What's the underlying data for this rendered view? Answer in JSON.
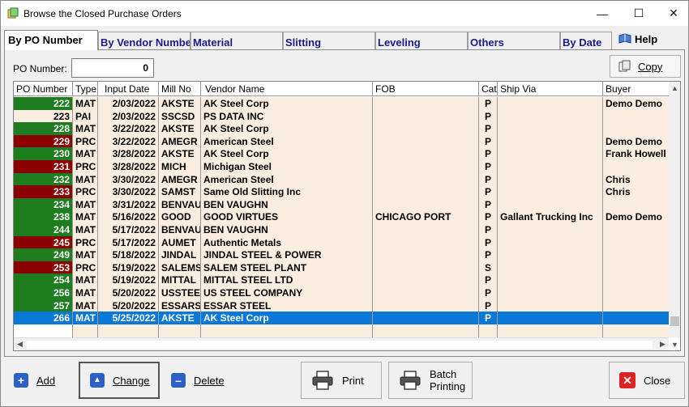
{
  "window": {
    "title": "Browse the Closed Purchase Orders",
    "minimize": "—",
    "maximize": "☐",
    "close": "✕"
  },
  "tabs": [
    "By PO Number",
    "By Vendor Number",
    "Material",
    "Slitting",
    "Leveling",
    "Others",
    "By Date"
  ],
  "help_label": "Help",
  "po_label": "PO Number:",
  "po_value": "0",
  "copy_label": "Copy",
  "columns": [
    "PO Number",
    "Type",
    "Input Date",
    "Mill No",
    "Vendor Name",
    "FOB",
    "Cat",
    "Ship Via",
    "Buyer"
  ],
  "rows": [
    {
      "po": "222",
      "status": "green",
      "type": "MAT",
      "date": "2/03/2022",
      "mill": "AKSTE",
      "vendor": "AK Steel Corp",
      "fob": "",
      "cat": "P",
      "ship": "",
      "buyer": "Demo Demo"
    },
    {
      "po": "223",
      "status": "plain",
      "type": "PAI",
      "date": "2/03/2022",
      "mill": "SSCSD",
      "vendor": "PS DATA INC",
      "fob": "",
      "cat": "P",
      "ship": "",
      "buyer": ""
    },
    {
      "po": "228",
      "status": "green",
      "type": "MAT",
      "date": "3/22/2022",
      "mill": "AKSTE",
      "vendor": "AK Steel Corp",
      "fob": "",
      "cat": "P",
      "ship": "",
      "buyer": ""
    },
    {
      "po": "229",
      "status": "red",
      "type": "PRC",
      "date": "3/22/2022",
      "mill": "AMEGR",
      "vendor": "American Steel",
      "fob": "",
      "cat": "P",
      "ship": "",
      "buyer": "Demo Demo"
    },
    {
      "po": "230",
      "status": "green",
      "type": "MAT",
      "date": "3/28/2022",
      "mill": "AKSTE",
      "vendor": "AK Steel Corp",
      "fob": "",
      "cat": "P",
      "ship": "",
      "buyer": "Frank Howell"
    },
    {
      "po": "231",
      "status": "red",
      "type": "PRC",
      "date": "3/28/2022",
      "mill": "MICH",
      "vendor": "Michigan Steel",
      "fob": "",
      "cat": "P",
      "ship": "",
      "buyer": ""
    },
    {
      "po": "232",
      "status": "green",
      "type": "MAT",
      "date": "3/30/2022",
      "mill": "AMEGR",
      "vendor": "American Steel",
      "fob": "",
      "cat": "P",
      "ship": "",
      "buyer": "Chris"
    },
    {
      "po": "233",
      "status": "red",
      "type": "PRC",
      "date": "3/30/2022",
      "mill": "SAMST",
      "vendor": "Same Old Slitting Inc",
      "fob": "",
      "cat": "P",
      "ship": "",
      "buyer": "Chris"
    },
    {
      "po": "234",
      "status": "green",
      "type": "MAT",
      "date": "3/31/2022",
      "mill": "BENVAU",
      "vendor": "BEN VAUGHN",
      "fob": "",
      "cat": "P",
      "ship": "",
      "buyer": ""
    },
    {
      "po": "238",
      "status": "green",
      "type": "MAT",
      "date": "5/16/2022",
      "mill": "GOOD",
      "vendor": "GOOD VIRTUES",
      "fob": "CHICAGO PORT",
      "cat": "P",
      "ship": "Gallant Trucking Inc",
      "buyer": "Demo Demo"
    },
    {
      "po": "244",
      "status": "green",
      "type": "MAT",
      "date": "5/17/2022",
      "mill": "BENVAU",
      "vendor": "BEN VAUGHN",
      "fob": "",
      "cat": "P",
      "ship": "",
      "buyer": ""
    },
    {
      "po": "245",
      "status": "red",
      "type": "PRC",
      "date": "5/17/2022",
      "mill": "AUMET",
      "vendor": "Authentic Metals",
      "fob": "",
      "cat": "P",
      "ship": "",
      "buyer": ""
    },
    {
      "po": "249",
      "status": "green",
      "type": "MAT",
      "date": "5/18/2022",
      "mill": "JINDAL",
      "vendor": "JINDAL STEEL & POWER",
      "fob": "",
      "cat": "P",
      "ship": "",
      "buyer": ""
    },
    {
      "po": "253",
      "status": "red",
      "type": "PRC",
      "date": "5/19/2022",
      "mill": "SALEMS",
      "vendor": "SALEM STEEL PLANT",
      "fob": "",
      "cat": "S",
      "ship": "",
      "buyer": ""
    },
    {
      "po": "254",
      "status": "green",
      "type": "MAT",
      "date": "5/19/2022",
      "mill": "MITTAL",
      "vendor": "MITTAL STEEL LTD",
      "fob": "",
      "cat": "P",
      "ship": "",
      "buyer": ""
    },
    {
      "po": "256",
      "status": "green",
      "type": "MAT",
      "date": "5/20/2022",
      "mill": "USSTEE",
      "vendor": "US STEEL COMPANY",
      "fob": "",
      "cat": "P",
      "ship": "",
      "buyer": ""
    },
    {
      "po": "257",
      "status": "green",
      "type": "MAT",
      "date": "5/20/2022",
      "mill": "ESSARS",
      "vendor": " ESSAR STEEL",
      "fob": "",
      "cat": "P",
      "ship": "",
      "buyer": ""
    },
    {
      "po": "266",
      "status": "green",
      "type": "MAT",
      "date": "5/25/2022",
      "mill": "AKSTE",
      "vendor": "AK Steel Corp",
      "fob": "",
      "cat": "P",
      "ship": "",
      "buyer": "",
      "selected": true
    }
  ],
  "buttons": {
    "add": "Add",
    "change": "Change",
    "delete": "Delete",
    "print": "Print",
    "batch_line1": "Batch",
    "batch_line2": "Printing",
    "close": "Close"
  },
  "colors": {
    "green": "#1e7d1e",
    "red": "#8b0000",
    "selection": "#0a78d7",
    "row_bg": "#fbeee0"
  }
}
